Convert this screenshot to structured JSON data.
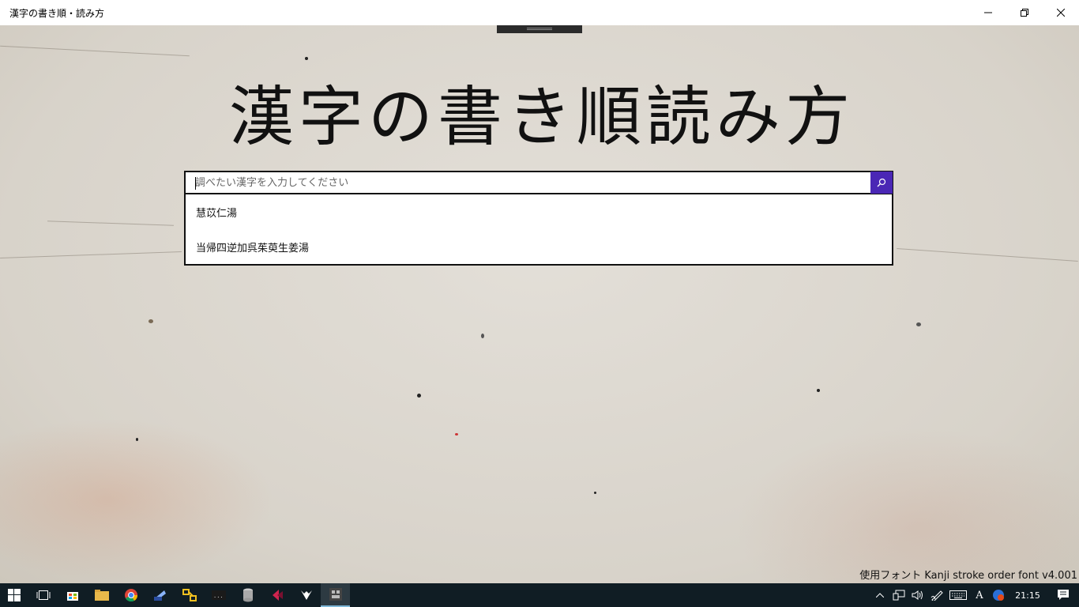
{
  "window": {
    "title": "漢字の書き順・読み方"
  },
  "app": {
    "heading": "漢字の書き順読み方",
    "search": {
      "placeholder": "調べたい漢字を入力してください",
      "value": ""
    },
    "suggestions": [
      "慧苡仁湯",
      "当帰四逆加呉茱萸生姜湯"
    ],
    "credit": "使用フォント Kanji stroke order font v4.001"
  },
  "colors": {
    "accent": "#4a27b5",
    "taskbar": "#101d24"
  },
  "taskbar": {
    "items": [
      "start-icon",
      "task-view-icon",
      "store-icon",
      "file-explorer-icon",
      "chrome-icon",
      "app-icon",
      "ftp-icon",
      "terminal-icon",
      "database-icon",
      "app-red-icon",
      "app-fox-icon",
      "kanji-app-icon"
    ],
    "clock": "21:15",
    "ime_indicator": "A"
  }
}
